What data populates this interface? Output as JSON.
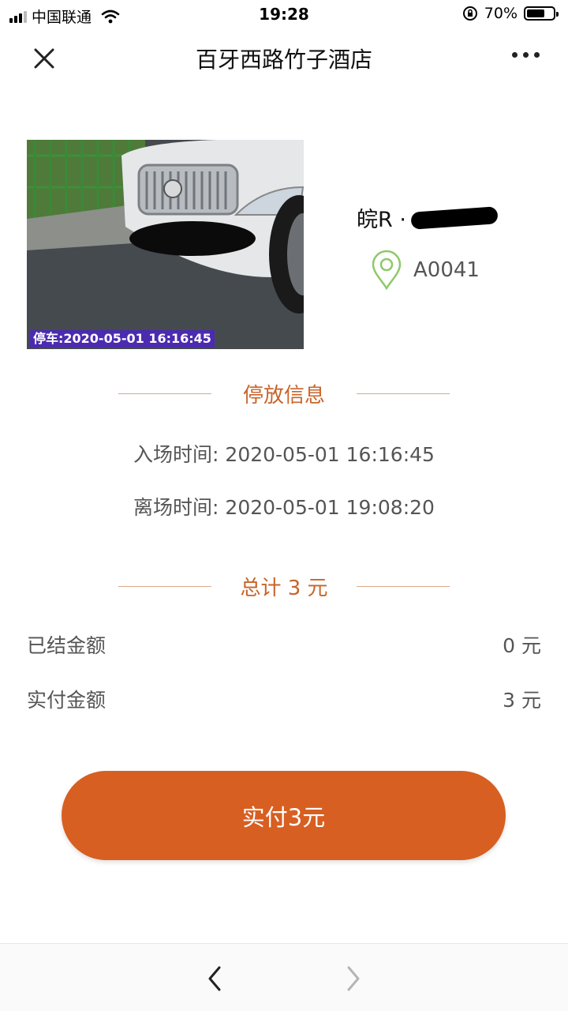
{
  "status_bar": {
    "carrier": "中国联通",
    "time": "19:28",
    "battery": "70%",
    "battery_level": 0.7
  },
  "header": {
    "title": "百牙西路竹子酒店",
    "close_icon": "close-icon",
    "more_icon": "more-icon"
  },
  "vehicle": {
    "plate_prefix": "皖R ·",
    "spot_icon": "location-pin-icon",
    "spot_color": "#8dc96a",
    "spot": "A0041",
    "photo_stamp": "停车:2020-05-01 16:16:45"
  },
  "parking_info": {
    "section_title": "停放信息",
    "entry_time": "入场时间: 2020-05-01 16:16:45",
    "exit_time": "离场时间: 2020-05-01 19:08:20"
  },
  "total": {
    "section_title": "总计 3 元",
    "accent_color": "#c8642a"
  },
  "amounts": {
    "settled_label": "已结金额",
    "settled_value": "0 元",
    "paid_label": "实付金额",
    "paid_value": "3 元"
  },
  "pay_button": {
    "label": "实付3元",
    "color": "#d75f22"
  },
  "bottom_nav": {
    "back_icon": "chevron-left-icon",
    "forward_icon": "chevron-right-icon"
  }
}
